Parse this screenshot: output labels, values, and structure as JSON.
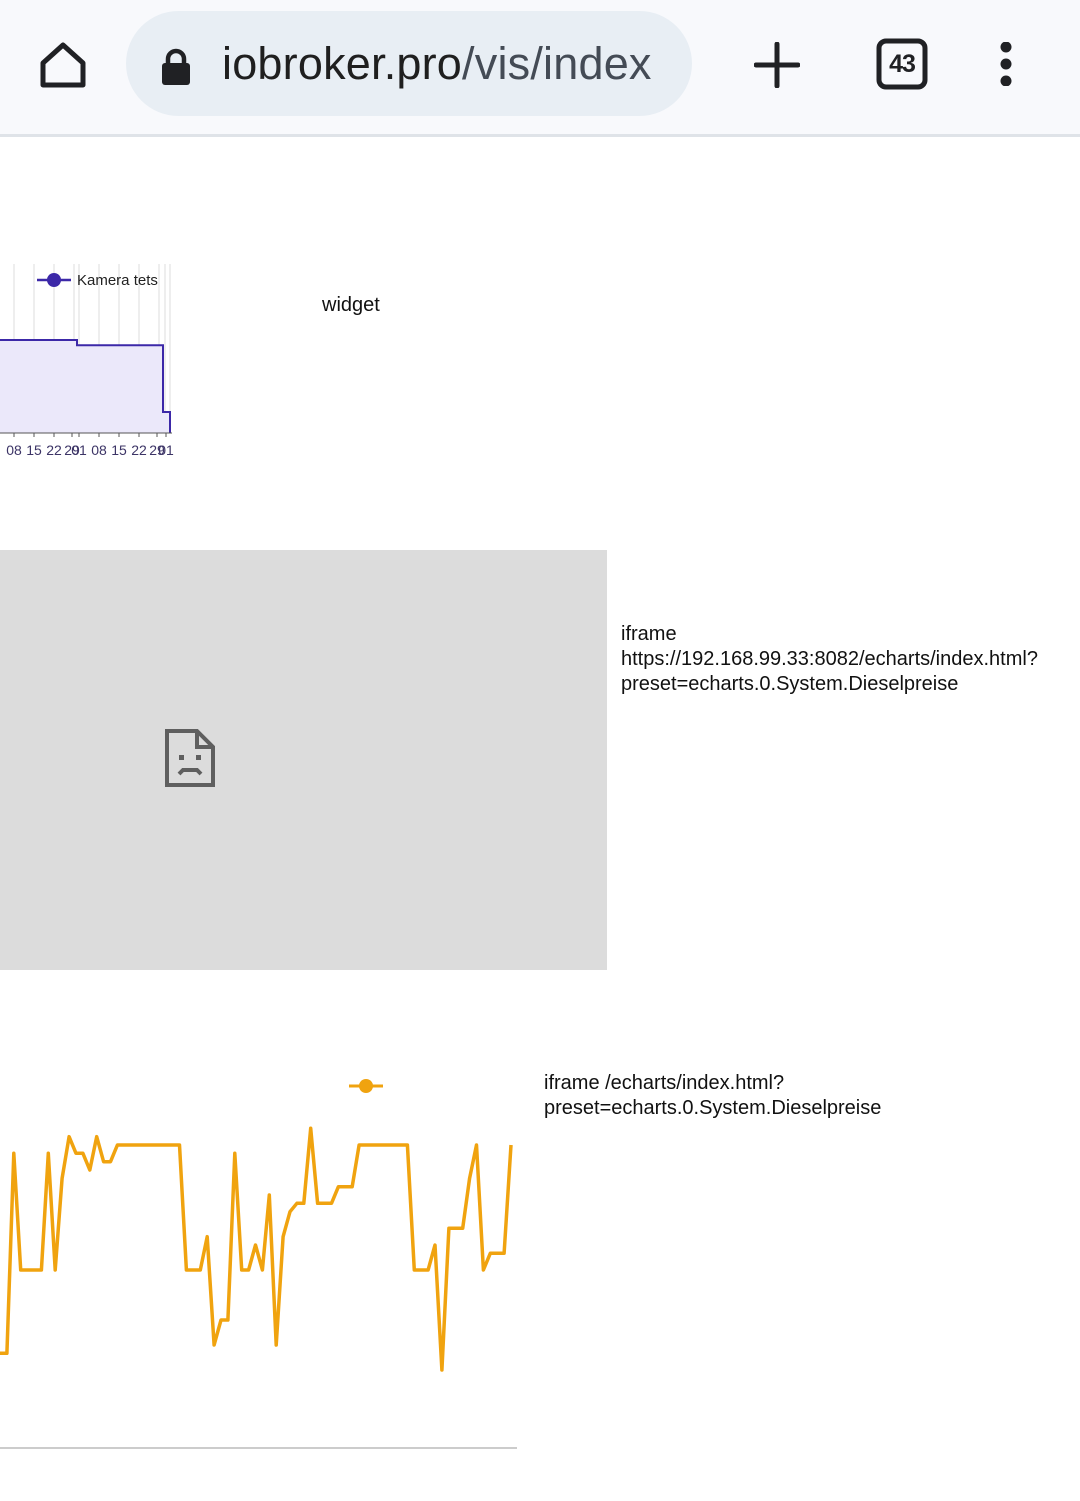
{
  "browser": {
    "url_host": "iobroker.pro",
    "url_path": "/vis/index",
    "tab_count": "43",
    "icons": [
      "home-icon",
      "lock-icon",
      "plus-icon",
      "tab-switcher-icon",
      "more-vert-icon"
    ]
  },
  "page": {
    "widget_label": "widget",
    "iframe1_label": "iframe https://192.168.99.33:8082/echarts/index.html?preset=echarts.0.System.Dieselpreise",
    "iframe1_lines": [
      "iframe",
      "https://192.168.99.33:8082/echarts/index.html?",
      "preset=echarts.0.System.Dieselpreise"
    ],
    "iframe2_lines": [
      "iframe /echarts/index.html?",
      "preset=echarts.0.System.Dieselpreise"
    ],
    "iframe_placeholder_icon": "sad-page-icon"
  },
  "chart_data": [
    {
      "type": "area",
      "legend": [
        "Kamera tets"
      ],
      "legend_position": "top",
      "color": "#3c28a8",
      "fill": "#ebe8fa",
      "x_tick_labels": [
        "08",
        "15",
        "22",
        "29",
        "01",
        "08",
        "15",
        "22",
        "29",
        "01"
      ],
      "series": [
        {
          "name": "Kamera tets",
          "step": true,
          "values": [
            {
              "x": 0,
              "y": 0.71
            },
            {
              "x": 77,
              "y": 0.71
            },
            {
              "x": 77,
              "y": 0.67
            },
            {
              "x": 163,
              "y": 0.67
            },
            {
              "x": 163,
              "y": 0.16
            },
            {
              "x": 170,
              "y": 0.16
            },
            {
              "x": 170,
              "y": 0
            }
          ]
        }
      ],
      "grid": true
    },
    {
      "type": "line",
      "color": "#f0a30f",
      "legend_position": "top",
      "grid": false,
      "series": [
        {
          "values": [
            1.75,
            1.75,
            1.99,
            1.85,
            1.85,
            1.85,
            1.85,
            1.99,
            1.85,
            1.96,
            2.01,
            1.99,
            1.99,
            1.97,
            2.01,
            1.98,
            1.98,
            2.0,
            2.0,
            2.0,
            2.0,
            2.0,
            2.0,
            2.0,
            2.0,
            2.0,
            2.0,
            1.85,
            1.85,
            1.85,
            1.89,
            1.76,
            1.79,
            1.79,
            1.99,
            1.85,
            1.85,
            1.88,
            1.85,
            1.94,
            1.76,
            1.89,
            1.92,
            1.93,
            1.93,
            2.02,
            1.93,
            1.93,
            1.93,
            1.95,
            1.95,
            1.95,
            2.0,
            2.0,
            2.0,
            2.0,
            2.0,
            2.0,
            2.0,
            2.0,
            1.85,
            1.85,
            1.85,
            1.88,
            1.73,
            1.9,
            1.9,
            1.9,
            1.96,
            2.0,
            1.85,
            1.87,
            1.87,
            1.87,
            2.0
          ]
        }
      ]
    }
  ]
}
